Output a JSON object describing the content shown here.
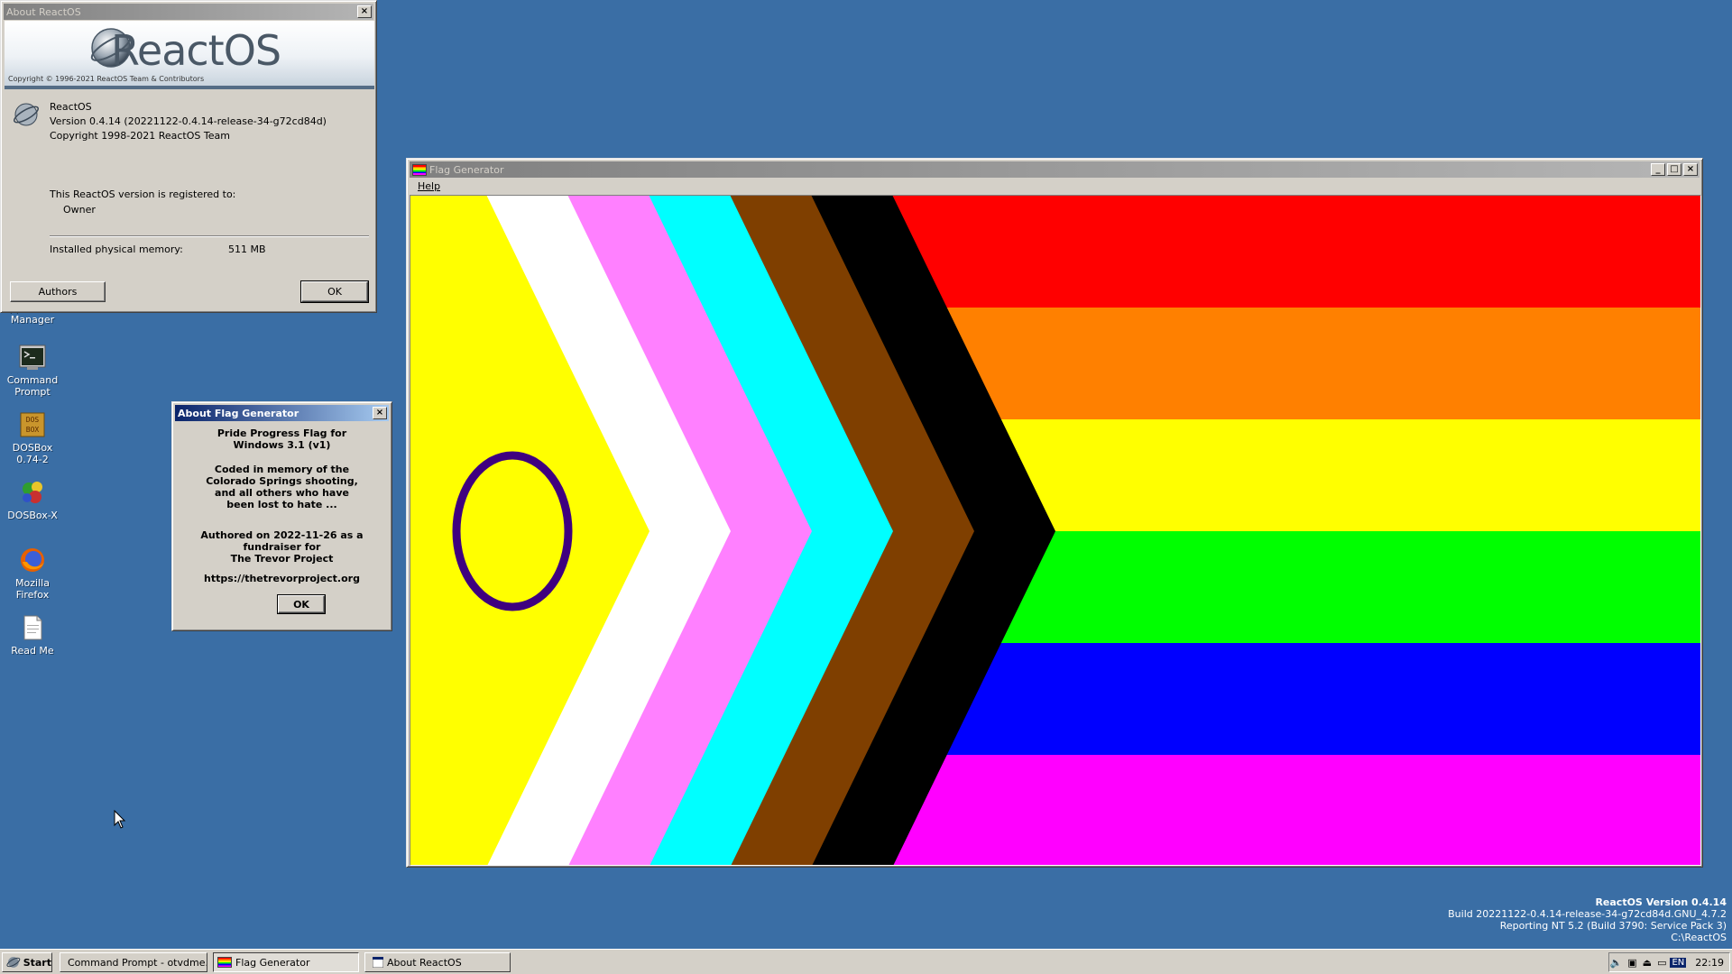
{
  "desktop": {
    "icons": [
      {
        "label": "Applications\nManager"
      },
      {
        "label": "Command\nPrompt"
      },
      {
        "label": "DOSBox\n0.74-2"
      },
      {
        "label": "DOSBox-X"
      },
      {
        "label": "Mozilla\nFirefox"
      },
      {
        "label": "Read Me"
      }
    ],
    "watermark": {
      "line1": "ReactOS Version 0.4.14",
      "line2": "Build 20221122-0.4.14-release-34-g72cd84d.GNU_4.7.2",
      "line3": "Reporting NT 5.2 (Build 3790: Service Pack 3)",
      "line4": "C:\\ReactOS"
    }
  },
  "about_reactos": {
    "title": "About ReactOS",
    "banner_logo": "ReactOS",
    "banner_copyright": "Copyright © 1996-2021 ReactOS Team & Contributors",
    "product": "ReactOS",
    "version": "Version 0.4.14 (20221122-0.4.14-release-34-g72cd84d)",
    "copyright": "Copyright 1998-2021  ReactOS Team",
    "registered_label": "This ReactOS version is registered to:",
    "owner": "Owner",
    "memory_label": "Installed physical memory:",
    "memory_value": "511 MB",
    "authors_button": "Authors",
    "ok_button": "OK"
  },
  "about_flag": {
    "title": "About Flag Generator",
    "line1": "Pride Progress Flag for",
    "line2": "Windows 3.1 (v1)",
    "line3": "Coded in memory of the",
    "line4": "Colorado Springs shooting,",
    "line5": "and all others who have",
    "line6": "been lost to hate ...",
    "line7": "Authored on 2022-11-26 as a",
    "line8": "fundraiser for",
    "line9": "The Trevor Project",
    "url": "https://thetrevorproject.org",
    "ok_button": "OK"
  },
  "flag_generator": {
    "title": "Flag Generator",
    "menu_help": "Help",
    "minimize": "_",
    "maximize": "□",
    "close": "×",
    "colors": {
      "stripes": [
        "#ff0000",
        "#ff8000",
        "#ffff00",
        "#00ff00",
        "#0000ff",
        "#ff00ff"
      ],
      "chevrons": [
        "#000000",
        "#7f3f00",
        "#00ffff",
        "#ff80ff",
        "#ffffff",
        "#ffff00"
      ],
      "circle": "#3f007f"
    }
  },
  "taskbar": {
    "start": "Start",
    "tasks": [
      {
        "label": "Command Prompt - otvdme..."
      },
      {
        "label": "Flag Generator"
      },
      {
        "label": "About ReactOS"
      }
    ],
    "lang": "EN",
    "clock": "22:19"
  }
}
